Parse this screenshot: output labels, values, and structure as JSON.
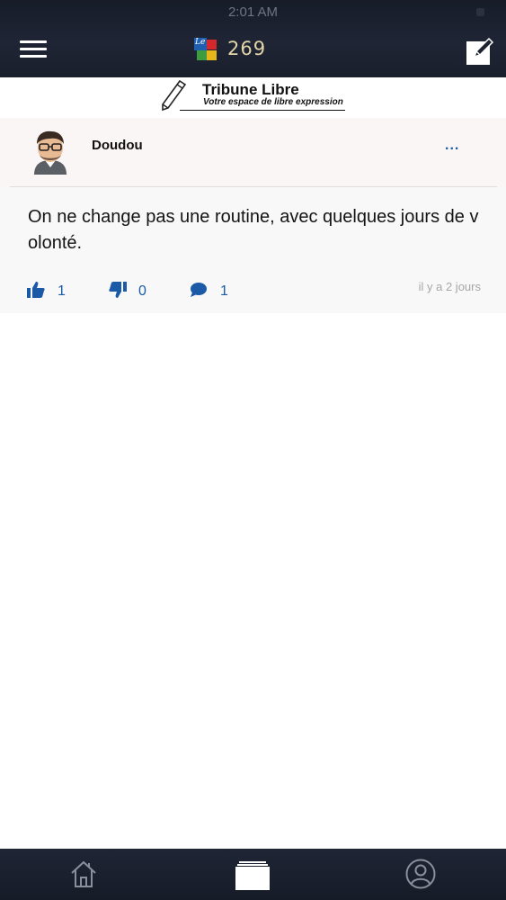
{
  "status_bar": {
    "time": "2:01 AM"
  },
  "header": {
    "logo_prefix": "Le",
    "logo_number": "269",
    "brand_colors": [
      "#1f5fb0",
      "#d4282d",
      "#3d9c3f",
      "#e7b61b"
    ]
  },
  "banner": {
    "title": "Tribune Libre",
    "subtitle": "Votre espace de libre expression"
  },
  "post": {
    "author": "Doudou",
    "more_label": "...",
    "text": "On ne change pas une routine, avec quelques jours de volonté.",
    "likes": "1",
    "dislikes": "0",
    "comments": "1",
    "time_ago": "il y a 2 jours"
  },
  "tabbar": {
    "items": [
      {
        "icon": "home-icon"
      },
      {
        "icon": "feed-icon"
      },
      {
        "icon": "profile-icon"
      }
    ]
  },
  "accent_color": "#1a5aa6"
}
